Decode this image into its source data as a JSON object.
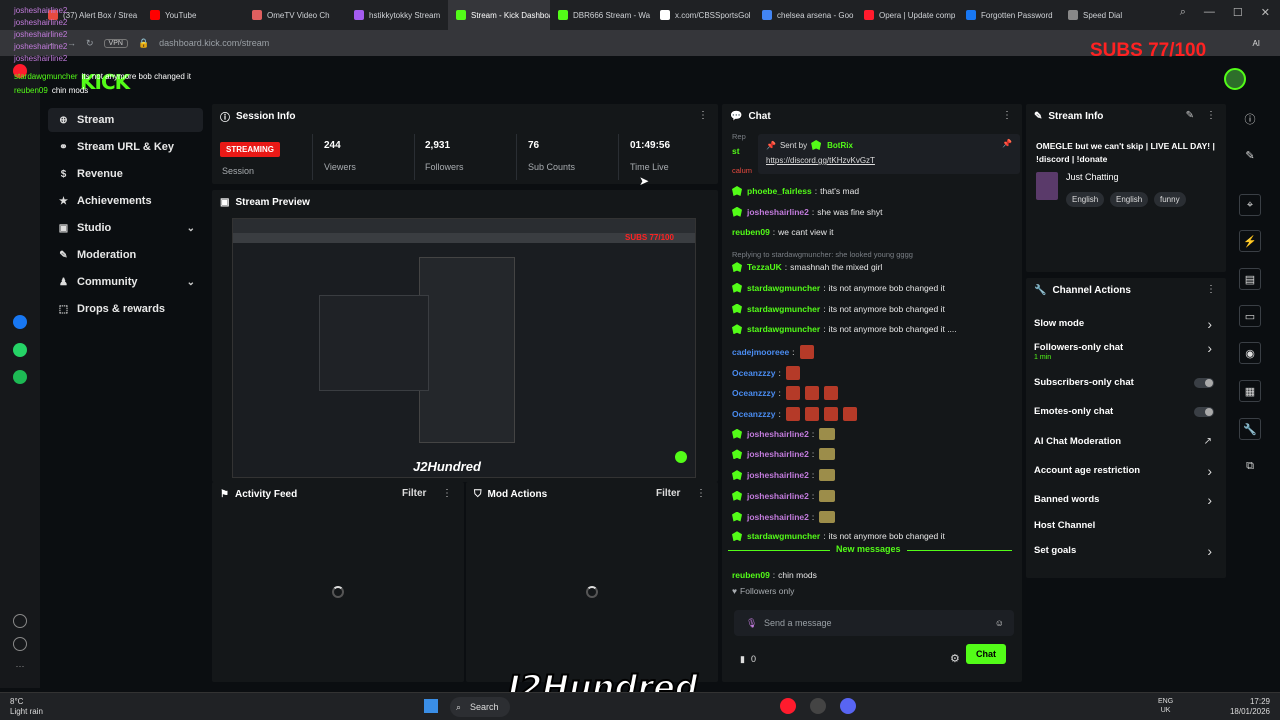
{
  "browser": {
    "tabs": [
      {
        "label": "(37) Alert Box / Strea",
        "color": "#e84a3f"
      },
      {
        "label": "YouTube",
        "color": "#ff0000"
      },
      {
        "label": "OmeTV Video Ch",
        "color": "#e05f5f"
      },
      {
        "label": "hstikkytokky Stream",
        "color": "#a45cf0"
      },
      {
        "label": "Stream - Kick Dashboard",
        "color": "#53fc18"
      },
      {
        "label": "DBR666 Stream - Wa",
        "color": "#53fc18"
      },
      {
        "label": "x.com/CBSSportsGol",
        "color": "#ffffff"
      },
      {
        "label": "chelsea arsena - Goo",
        "color": "#4285f4"
      },
      {
        "label": "Opera | Update comp",
        "color": "#ff1b2d"
      },
      {
        "label": "Forgotten Password",
        "color": "#1877f2"
      },
      {
        "label": "Speed Dial",
        "color": "#888888"
      }
    ],
    "vpn": "VPN",
    "url": "dashboard.kick.com/stream",
    "ai_label": "AI"
  },
  "header": {
    "logo": "KICK"
  },
  "nav": {
    "items": [
      {
        "label": "Stream",
        "icon": "⊕",
        "active": true
      },
      {
        "label": "Stream URL & Key",
        "icon": "⚭"
      },
      {
        "label": "Revenue",
        "icon": "$"
      },
      {
        "label": "Achievements",
        "icon": "★"
      },
      {
        "label": "Studio",
        "icon": "▣",
        "chevron": "⌄"
      },
      {
        "label": "Moderation",
        "icon": "✎"
      },
      {
        "label": "Community",
        "icon": "♟",
        "chevron": "⌄"
      },
      {
        "label": "Drops & rewards",
        "icon": "⬚"
      }
    ]
  },
  "session": {
    "title": "Session Info",
    "status": "STREAMING",
    "status_label": "Session",
    "viewers": "244",
    "viewers_label": "Viewers",
    "followers": "2,931",
    "followers_label": "Followers",
    "subs": "76",
    "subs_label": "Sub Counts",
    "time": "01:49:56",
    "time_label": "Time Live"
  },
  "preview": {
    "title": "Stream Preview",
    "overlay": "SUBS 77/100",
    "brand": "J2Hundred"
  },
  "activity": {
    "title": "Activity Feed",
    "filter": "Filter"
  },
  "modactions": {
    "title": "Mod Actions",
    "filter": "Filter"
  },
  "chat": {
    "title": "Chat",
    "pinned_by": "Sent by",
    "pinned_user": "BotRix",
    "pinned_link": "https://discord.gg/tKHzvKvGzT",
    "reply_partial": "Rep",
    "st_partial": "st",
    "calum_partial": "calum",
    "messages": [
      {
        "user": "phoebe_fairless",
        "color": "#53fc18",
        "text": "that's mad",
        "shield": true
      },
      {
        "user": "josheshairline2",
        "color": "#c27bdc",
        "text": "she was fine shyt",
        "shield": true
      },
      {
        "user": "reuben09",
        "color": "#53fc18",
        "text": "we cant view it"
      },
      {
        "reply": "Replying to stardawgmuncher: she looked young gggg"
      },
      {
        "user": "TezzaUK",
        "color": "#53fc18",
        "text": "smashnah the mixed girl",
        "shield": true
      },
      {
        "user": "stardawgmuncher",
        "color": "#53fc18",
        "text": "its not anymore bob changed it",
        "shield": true
      },
      {
        "user": "stardawgmuncher",
        "color": "#53fc18",
        "text": "its not anymore bob changed it",
        "shield": true
      },
      {
        "user": "stardawgmuncher",
        "color": "#53fc18",
        "text": "its not anymore bob changed it ....",
        "shield": true
      },
      {
        "user": "cadejmooreee",
        "color": "#4a8cf0",
        "text": "",
        "emotes": 1
      },
      {
        "user": "Oceanzzzy",
        "color": "#4a8cf0",
        "text": "",
        "emotes": 1
      },
      {
        "user": "Oceanzzzy",
        "color": "#4a8cf0",
        "text": "",
        "emotes": 3
      },
      {
        "user": "Oceanzzzy",
        "color": "#4a8cf0",
        "text": "",
        "emotes": 4
      },
      {
        "user": "josheshairline2",
        "color": "#c27bdc",
        "text": "",
        "shield": true,
        "gemotes": 1
      },
      {
        "user": "josheshairline2",
        "color": "#c27bdc",
        "text": "",
        "shield": true,
        "gemotes": 1
      },
      {
        "user": "josheshairline2",
        "color": "#c27bdc",
        "text": "",
        "shield": true,
        "gemotes": 1
      },
      {
        "user": "josheshairline2",
        "color": "#c27bdc",
        "text": "",
        "shield": true,
        "gemotes": 1
      },
      {
        "user": "josheshairline2",
        "color": "#c27bdc",
        "text": "",
        "shield": true,
        "gemotes": 1
      },
      {
        "user": "stardawgmuncher",
        "color": "#53fc18",
        "text": "its not anymore bob changed it",
        "shield": true
      }
    ],
    "new_messages": "New messages",
    "after_new": {
      "user": "reuben09",
      "color": "#53fc18",
      "text": "chin mods"
    },
    "followers_only": "Followers only",
    "send_placeholder": "Send a message",
    "count": "0",
    "send_button": "Chat"
  },
  "stream_info": {
    "title": "Stream Info",
    "stream_title": "OMEGLE but we can't skip | LIVE ALL DAY! | !discord | !donate",
    "category": "Just Chatting",
    "tags": [
      "English",
      "English",
      "funny"
    ]
  },
  "channel_actions": {
    "title": "Channel Actions",
    "items": [
      {
        "label": "Slow mode",
        "type": "chevron"
      },
      {
        "label": "Followers-only chat",
        "sub": "1 min",
        "type": "chevron"
      },
      {
        "label": "Subscribers-only chat",
        "type": "toggle"
      },
      {
        "label": "Emotes-only chat",
        "type": "toggle"
      },
      {
        "label": "AI Chat Moderation",
        "type": "external"
      },
      {
        "label": "Account age restriction",
        "type": "chevron"
      },
      {
        "label": "Banned words",
        "type": "chevron"
      },
      {
        "label": "Host Channel",
        "type": "none"
      },
      {
        "label": "Set goals",
        "type": "chevron"
      }
    ]
  },
  "overlay": {
    "subs": "SUBS 77/100",
    "brand": "J2Hundred",
    "chat_lines": [
      {
        "u": "josheshairline2",
        "t": ""
      },
      {
        "u": "josheshairline2",
        "t": ""
      },
      {
        "u": "josheshairline2",
        "t": ""
      },
      {
        "u": "josheshairline2",
        "t": ""
      },
      {
        "u": "josheshairline2",
        "t": ""
      },
      {
        "u": "stardawgmuncher",
        "t": "its not anymore bob changed it"
      },
      {
        "u": "reuben09",
        "t": "chin mods"
      }
    ]
  },
  "taskbar": {
    "temp": "8°C",
    "weather": "Light rain",
    "search": "Search",
    "lang": "ENG",
    "region": "UK",
    "time": "17:29",
    "date": "18/01/2026"
  }
}
